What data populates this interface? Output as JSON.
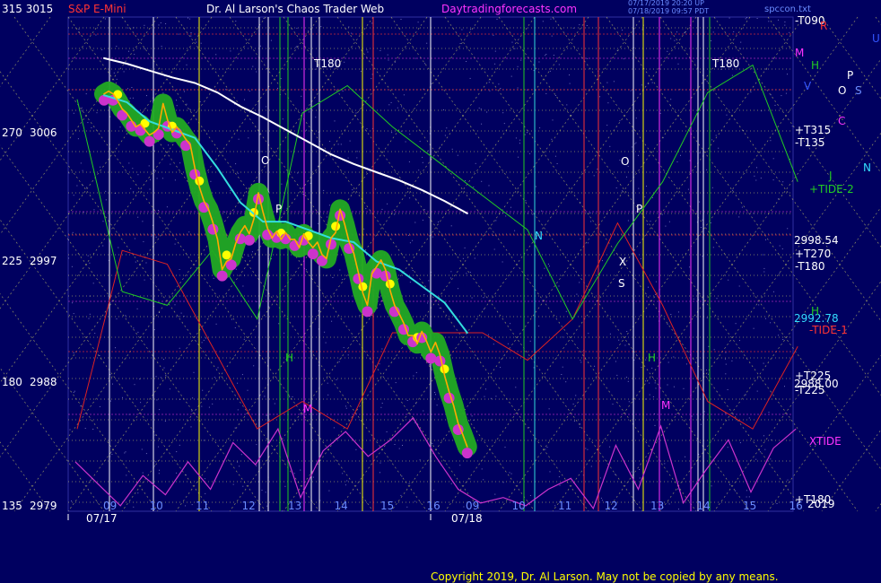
{
  "header": {
    "left": "315  3015",
    "instrument": "S&P E-Mini",
    "title": "Dr. Al Larson's Chaos Trader Web",
    "site": "Daytradingforecasts.com",
    "stamp1": "07/17/2019 20:20 UP",
    "stamp2": "07/18/2019 09:57 PDT",
    "file": "spccon.txt"
  },
  "footer": {
    "copyright": "Copyright 2019, Dr. Al Larson. May not be copied by any means."
  },
  "colors": {
    "background": "#000060",
    "grid": "#ffff66",
    "price": "#ffff00",
    "green_band": "#22aa22",
    "magenta": "#cc33cc",
    "cyan": "#33dddd",
    "white_line": "#ffffff",
    "red": "#dd2222",
    "green_line": "#22cc22",
    "orange_line": "#ffaa00"
  },
  "chart_data": {
    "type": "line",
    "title": "S&P E-Mini",
    "y_left_angle_labels": [
      "315",
      "270",
      "225",
      "180",
      "135"
    ],
    "y_left_price_labels": [
      "3015",
      "3006",
      "2997",
      "2988",
      "2979"
    ],
    "ylim": [
      2979,
      3015
    ],
    "x_labels": {
      "day1_hours": [
        "09",
        "10",
        "11",
        "12",
        "13",
        "14",
        "15",
        "16"
      ],
      "day2_hours": [
        "09",
        "10",
        "11",
        "12",
        "13",
        "14",
        "15",
        "16"
      ],
      "dates": [
        "07/17",
        "07/18"
      ]
    },
    "right_labels": {
      "price_markers": [
        "2998.54",
        "2992.78",
        "2988.00"
      ],
      "astro_markers": [
        "-T090",
        "+T315",
        "-T135",
        "+TIDE-2",
        "+T270",
        "-T180",
        "-TIDE-1",
        "+T225",
        "-T225",
        "XTIDE",
        "+T180",
        "2019"
      ],
      "planet_letters": [
        "R",
        "M",
        "H",
        "V",
        "P",
        "O",
        "S",
        "C",
        "N",
        "J",
        "U"
      ]
    },
    "chart_labels": [
      "T180",
      "T180",
      "O",
      "P",
      "N",
      "O",
      "P",
      "S",
      "X",
      "H",
      "H",
      "M",
      "M",
      "H"
    ],
    "series": [
      {
        "name": "price",
        "x": [
          0,
          0.1,
          0.2,
          0.3,
          0.4,
          0.5,
          0.6,
          0.7,
          0.8,
          0.9,
          1.0,
          1.1,
          1.2,
          1.3,
          1.4,
          1.5,
          1.6,
          1.7,
          1.8,
          1.9,
          2.0,
          2.1,
          2.2,
          2.3,
          2.4,
          2.5,
          2.6,
          2.7,
          2.8,
          2.9,
          3.0,
          3.1,
          3.2,
          3.3,
          3.4,
          3.5,
          3.6,
          3.7,
          3.8,
          3.9,
          4.0,
          4.1,
          4.2,
          4.3,
          4.4,
          4.5,
          4.6,
          4.7,
          4.8,
          4.9,
          5.0,
          5.1,
          5.2,
          5.3,
          5.4,
          5.5,
          5.6,
          5.7,
          5.8,
          5.9,
          6.0,
          6.1,
          6.2,
          6.3,
          6.4,
          6.5,
          6.6,
          6.7,
          6.8,
          6.9,
          7.0,
          7.1,
          7.2,
          7.3,
          7.4,
          7.5,
          7.6,
          7.7,
          7.8,
          7.9,
          8.0
        ],
        "values": [
          3009.4,
          3009.6,
          3009.4,
          3008.9,
          3008.3,
          3008.0,
          3007.5,
          3007.0,
          3007.2,
          3006.8,
          3006.4,
          3006.6,
          3006.9,
          3008.7,
          3007.5,
          3006.6,
          3007.0,
          3006.6,
          3006.1,
          3005.7,
          3004.0,
          3002.6,
          3001.6,
          3001.0,
          3000.0,
          2998.8,
          2996.6,
          2997.2,
          2997.4,
          2998.5,
          2999.3,
          2999.8,
          2999.2,
          3000.3,
          3002.2,
          3000.8,
          2999.6,
          2998.9,
          2999.4,
          2998.8,
          2999.3,
          2998.8,
          2998.8,
          2998.2,
          2999.2,
          2998.6,
          2998.2,
          2998.6,
          2997.7,
          2997.4,
          2998.9,
          2999.3,
          3001.0,
          2999.9,
          2998.6,
          2997.8,
          2996.4,
          2994.9,
          2994.0,
          2996.3,
          2996.8,
          2997.3,
          2996.6,
          2995.1,
          2994.0,
          2993.4,
          2992.7,
          2991.8,
          2991.8,
          2991.2,
          2992.1,
          2991.4,
          2990.6,
          2991.3,
          2990.4,
          2988.9,
          2987.7,
          2986.7,
          2985.4,
          2984.6,
          2983.7
        ]
      },
      {
        "name": "cyan",
        "x": [
          0,
          0.5,
          1.0,
          1.5,
          2.0,
          2.5,
          3.0,
          3.5,
          4.0,
          4.5,
          5.0,
          5.5,
          6.0,
          6.5,
          7.0,
          7.5,
          8.0
        ],
        "values": [
          3009.3,
          3008.8,
          3007.4,
          3006.8,
          3006.2,
          3004.0,
          3001.5,
          3000.1,
          3000.1,
          2999.5,
          2998.9,
          2998.6,
          2997.2,
          2996.6,
          2995.4,
          2994.2,
          2992.0
        ]
      },
      {
        "name": "white",
        "x": [
          0,
          0.5,
          1.0,
          1.5,
          2.0,
          2.5,
          3.0,
          3.5,
          4.0,
          4.5,
          5.0,
          5.5,
          6.0,
          6.5,
          7.0,
          7.5,
          8.0
        ],
        "values": [
          3012.0,
          3011.6,
          3011.1,
          3010.6,
          3010.2,
          3009.5,
          3008.5,
          3007.7,
          3006.8,
          3005.9,
          3005.0,
          3004.3,
          3003.7,
          3003.1,
          3002.4,
          3001.6,
          3000.7
        ]
      },
      {
        "name": "magenta-tide",
        "x": [
          0,
          0.5,
          1.0,
          1.5,
          2.0,
          2.5,
          3.0,
          3.5,
          4.0,
          4.5,
          5.0,
          5.5,
          6.0,
          6.5,
          7.0,
          7.5,
          8.0,
          8.5,
          9.0,
          9.5,
          10.0,
          10.5,
          11.0,
          11.5,
          12.0,
          12.5,
          13.0,
          13.5,
          14.0,
          14.5,
          15.0,
          15.5,
          16.0
        ],
        "values": [
          2982.6,
          2981.0,
          2979.4,
          2981.6,
          2980.2,
          2982.6,
          2980.6,
          2984.0,
          2982.4,
          2985.0,
          2980.0,
          2983.4,
          2984.8,
          2983.0,
          2984.2,
          2985.8,
          2983.0,
          2980.6,
          2979.6,
          2980.0,
          2979.4,
          2980.6,
          2981.4,
          2979.2,
          2983.8,
          2980.6,
          2985.2,
          2979.6,
          2982.0,
          2984.2,
          2980.4,
          2983.6,
          2985.0
        ]
      },
      {
        "name": "green-line",
        "x": [
          0,
          1,
          2,
          3,
          4,
          5,
          6,
          7,
          8,
          9,
          10,
          11,
          12,
          13,
          14,
          15,
          16
        ],
        "values": [
          3009.0,
          2995.0,
          2994.0,
          2998.0,
          2993.0,
          3008.0,
          3010.0,
          3007.0,
          3004.5,
          3002.0,
          2999.5,
          2993.0,
          2998.5,
          3003.0,
          3009.5,
          3011.5,
          3003.0
        ]
      },
      {
        "name": "red-line",
        "x": [
          0,
          1,
          2,
          3,
          4,
          5,
          6,
          7,
          8,
          9,
          10,
          11,
          12,
          13,
          14,
          15,
          16
        ],
        "values": [
          2985.0,
          2998.0,
          2997.0,
          2991.0,
          2985.0,
          2987.0,
          2985.0,
          2992.0,
          2992.0,
          2992.0,
          2990.0,
          2993.0,
          3000.0,
          2994.0,
          2987.0,
          2985.0,
          2991.0
        ]
      }
    ]
  }
}
